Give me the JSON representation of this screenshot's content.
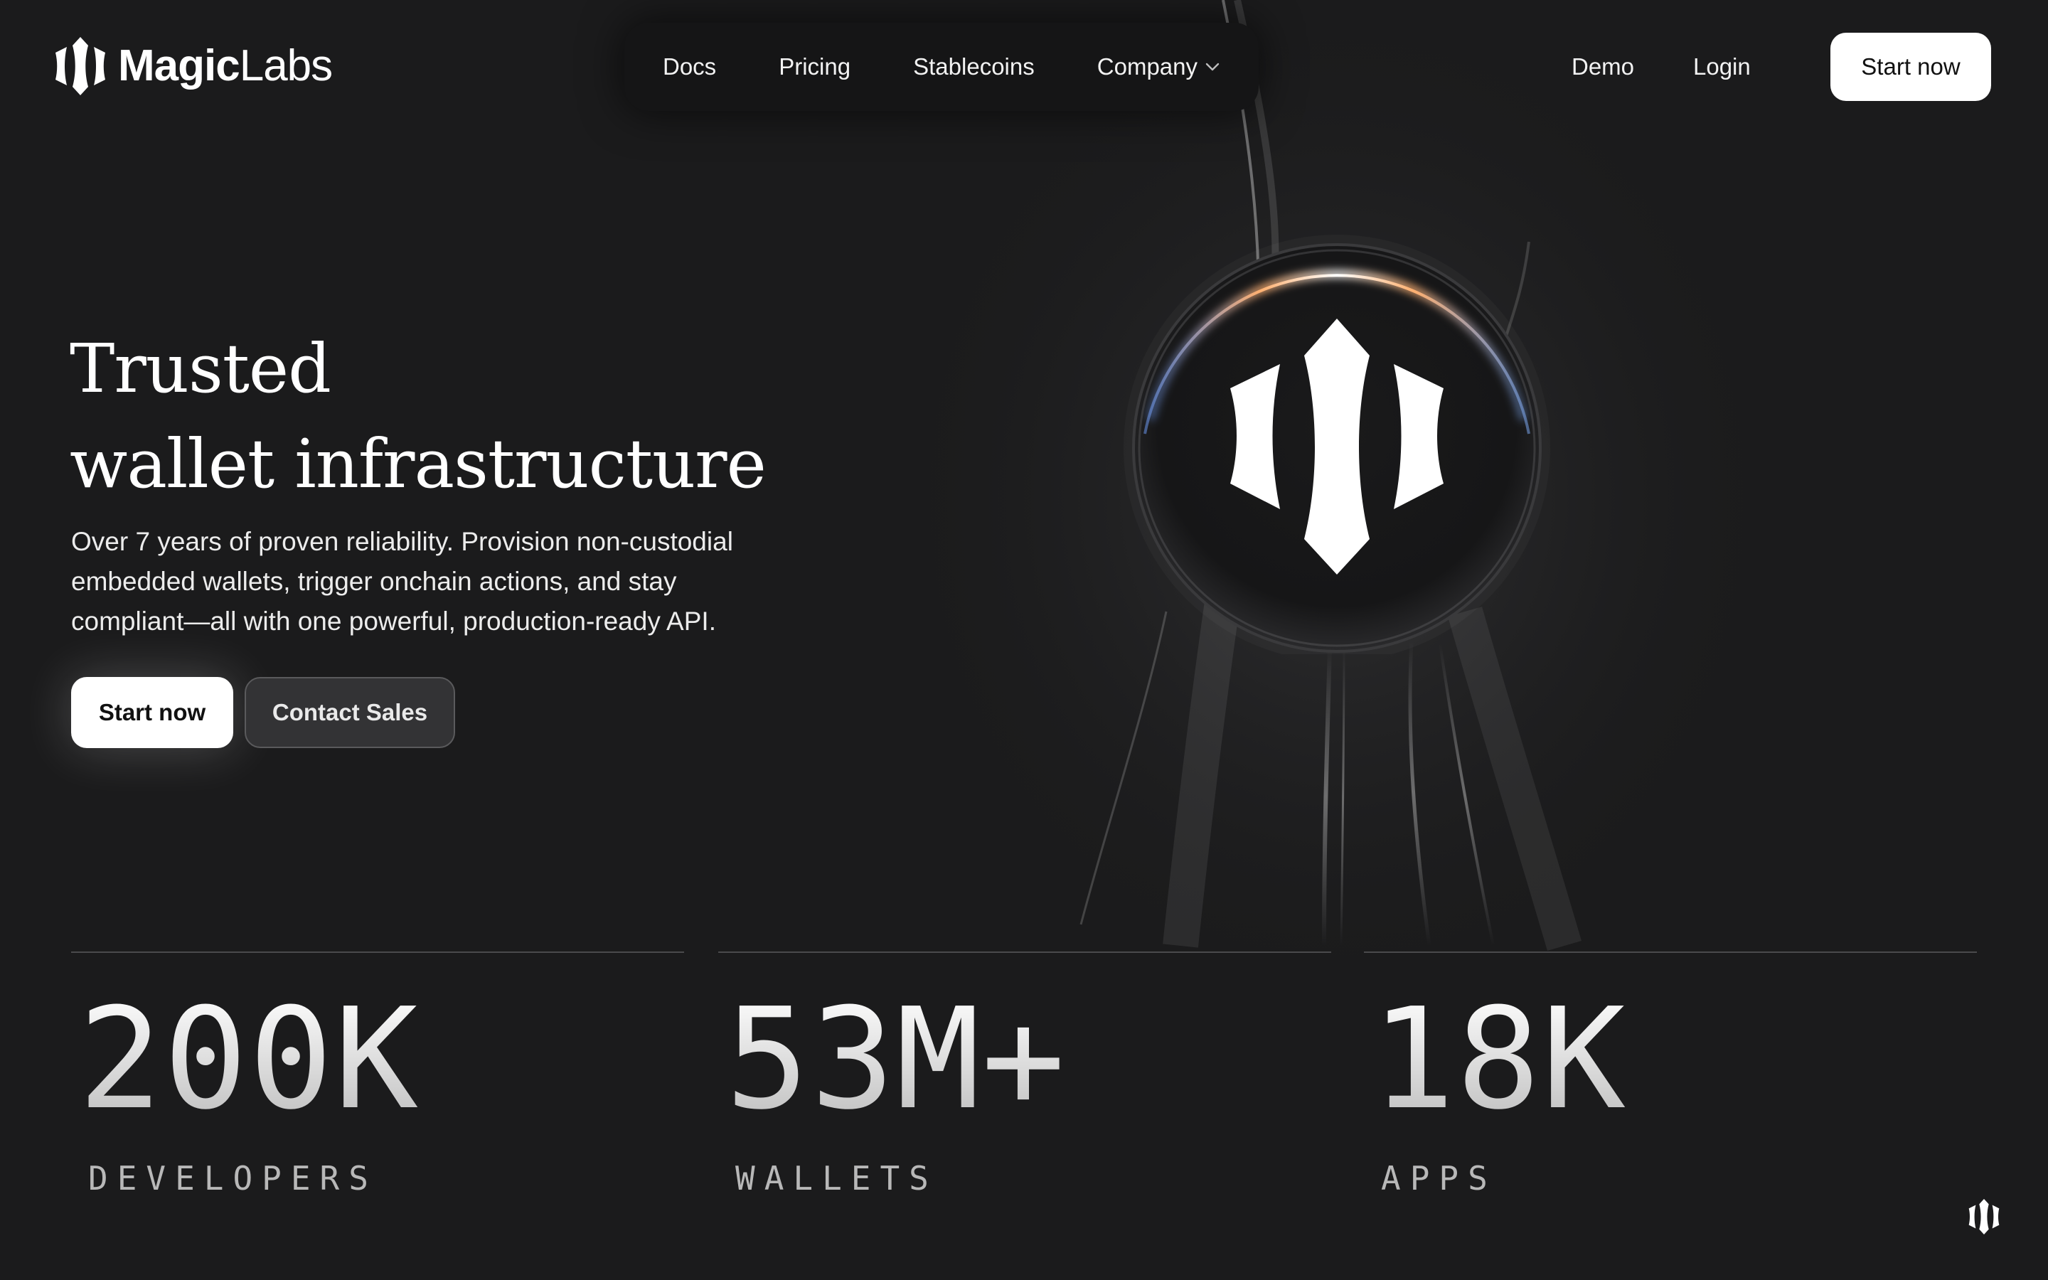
{
  "brand": {
    "name_bold": "Magic",
    "name_light": "Labs"
  },
  "nav": {
    "items": [
      {
        "label": "Docs"
      },
      {
        "label": "Pricing"
      },
      {
        "label": "Stablecoins"
      },
      {
        "label": "Company",
        "has_dropdown": true
      }
    ],
    "demo_label": "Demo",
    "login_label": "Login",
    "start_label": "Start now"
  },
  "hero": {
    "title_lines": [
      "Trusted",
      "wallet infrastructure"
    ],
    "description_lines": [
      "Over 7 years of proven reliability. Provision non-custodial",
      "embedded wallets, trigger onchain actions, and stay",
      "compliant—all with one powerful, production-ready API."
    ],
    "primary_cta": "Start now",
    "secondary_cta": "Contact Sales"
  },
  "stats": [
    {
      "value": "200K",
      "label": "DEVELOPERS"
    },
    {
      "value": "53M+",
      "label": "WALLETS"
    },
    {
      "value": "18K",
      "label": "APPS"
    }
  ],
  "icons": {
    "brand_logo": "magic-logo-icon",
    "dropdown": "chevron-down-icon",
    "floating": "magic-logo-icon"
  },
  "colors": {
    "background": "#1b1b1c",
    "nav_pill": "#151516",
    "primary_button": "#ffffff",
    "secondary_button": "#333335",
    "text": "#ffffff"
  }
}
